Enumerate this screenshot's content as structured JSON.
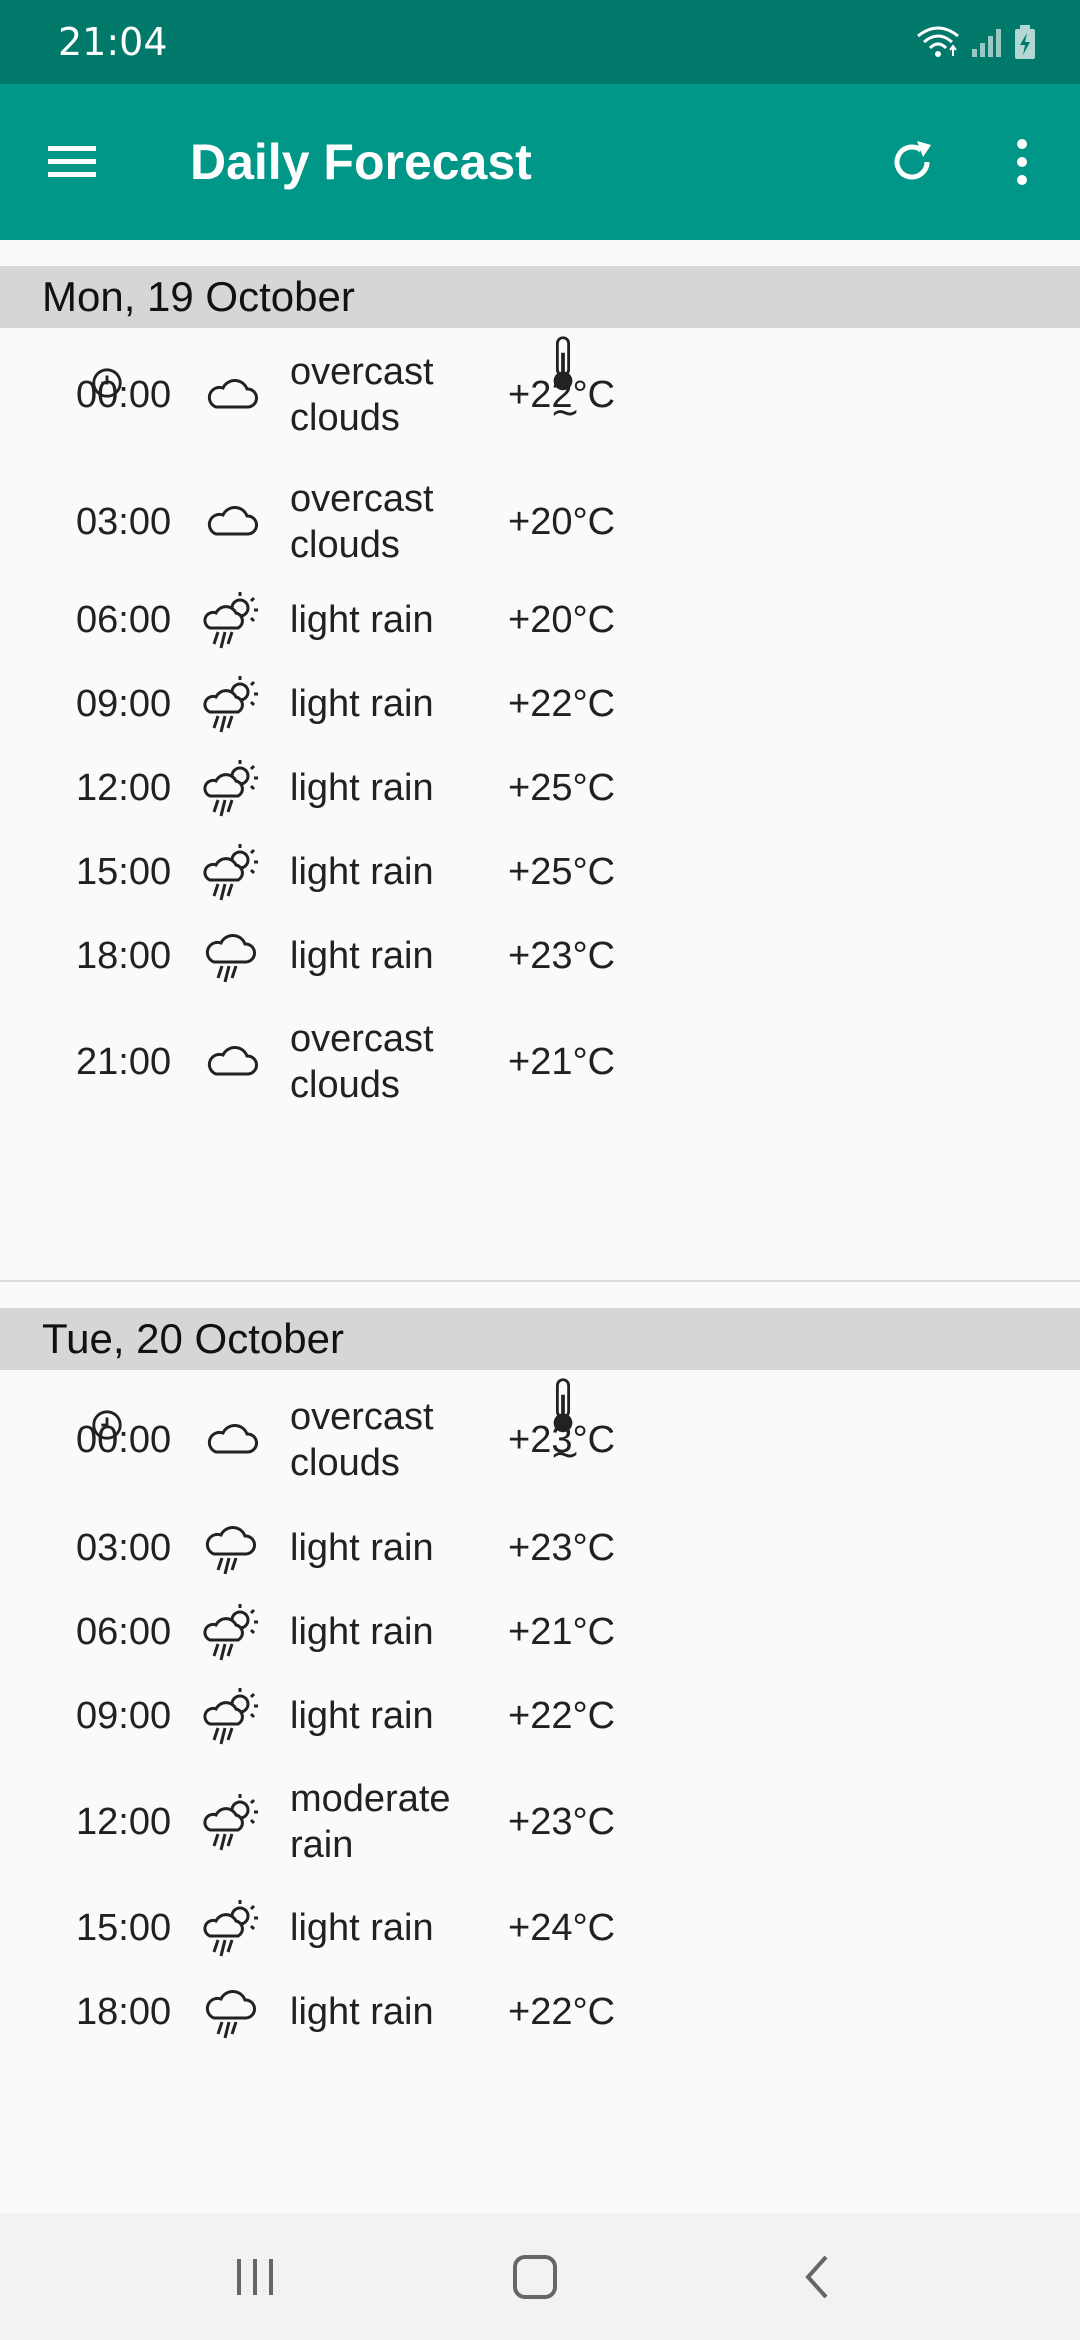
{
  "status_bar": {
    "time": "21:04",
    "icons": [
      "wifi-icon",
      "signal-icon",
      "battery-charging-icon"
    ]
  },
  "app_bar": {
    "title": "Daily Forecast",
    "icons": [
      "menu-icon",
      "refresh-icon",
      "more-vert-icon"
    ],
    "color": "#009688",
    "status_color": "#00796b"
  },
  "table_header": {
    "icons": [
      "clock-icon",
      "thermometer-icon"
    ],
    "tilde": "~"
  },
  "days": [
    {
      "date": "Mon, 19 October",
      "rows": [
        {
          "time": "00:00",
          "icon": "cloud-icon",
          "desc": "overcast clouds",
          "temp": "+22°C"
        },
        {
          "time": "03:00",
          "icon": "cloud-icon",
          "desc": "overcast clouds",
          "temp": "+20°C"
        },
        {
          "time": "06:00",
          "icon": "sun-rain-icon",
          "desc": "light rain",
          "temp": "+20°C"
        },
        {
          "time": "09:00",
          "icon": "sun-rain-icon",
          "desc": "light rain",
          "temp": "+22°C"
        },
        {
          "time": "12:00",
          "icon": "sun-rain-icon",
          "desc": "light rain",
          "temp": "+25°C"
        },
        {
          "time": "15:00",
          "icon": "sun-rain-icon",
          "desc": "light rain",
          "temp": "+25°C"
        },
        {
          "time": "18:00",
          "icon": "cloud-rain-icon",
          "desc": "light rain",
          "temp": "+23°C"
        },
        {
          "time": "21:00",
          "icon": "cloud-icon",
          "desc": "overcast clouds",
          "temp": "+21°C"
        }
      ]
    },
    {
      "date": "Tue, 20 October",
      "rows": [
        {
          "time": "00:00",
          "icon": "cloud-icon",
          "desc": "overcast clouds",
          "temp": "+23°C"
        },
        {
          "time": "03:00",
          "icon": "cloud-rain-icon",
          "desc": "light rain",
          "temp": "+23°C"
        },
        {
          "time": "06:00",
          "icon": "sun-rain-icon",
          "desc": "light rain",
          "temp": "+21°C"
        },
        {
          "time": "09:00",
          "icon": "sun-rain-icon",
          "desc": "light rain",
          "temp": "+22°C"
        },
        {
          "time": "12:00",
          "icon": "sun-rain-icon",
          "desc": "moderate rain",
          "temp": "+23°C"
        },
        {
          "time": "15:00",
          "icon": "sun-rain-icon",
          "desc": "light rain",
          "temp": "+24°C"
        },
        {
          "time": "18:00",
          "icon": "cloud-rain-icon",
          "desc": "light rain",
          "temp": "+22°C"
        }
      ]
    }
  ],
  "nav_bar": {
    "icons": [
      "recent-apps-icon",
      "home-icon",
      "back-icon"
    ]
  }
}
